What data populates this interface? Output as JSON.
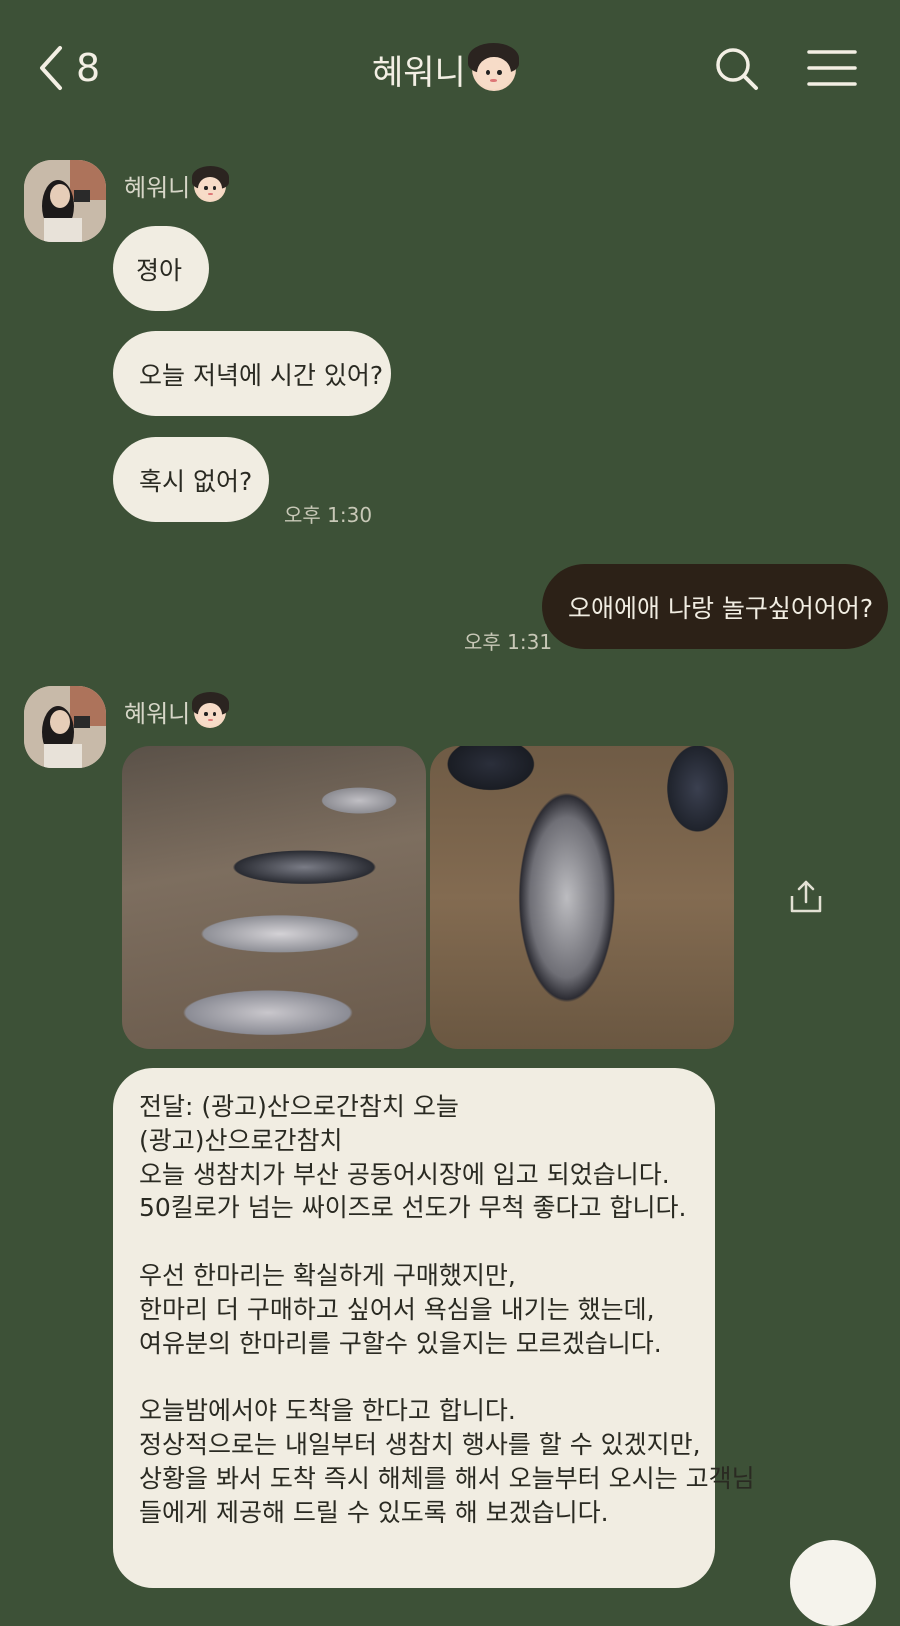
{
  "header": {
    "back_count": "8",
    "title": "혜워니"
  },
  "messages": {
    "group1": {
      "sender": "혜워니",
      "bubble1": "졍아",
      "bubble2": "오늘 저녁에 시간 있어?",
      "bubble3": "혹시 없어?",
      "time": "오후 1:30"
    },
    "mine1": {
      "text": "오애에애 나랑 놀구싶어어어?",
      "time": "오후 1:31"
    },
    "group2": {
      "sender": "혜워니",
      "long_message": [
        "전달: (광고)산으로간참치 오늘",
        "(광고)산으로간참치",
        "오늘 생참치가 부산 공동어시장에 입고 되었습니다.",
        "50킬로가 넘는 싸이즈로 선도가 무척 좋다고 합니다.",
        "",
        "우선 한마리는 확실하게 구매했지만,",
        "한마리 더 구매하고 싶어서 욕심을 내기는 했는데,",
        "여유분의 한마리를 구할수 있을지는 모르겠습니다.",
        "",
        "오늘밤에서야 도착을 한다고 합니다.",
        "정상적으로는 내일부터 생참치 행사를 할 수 있겠지만,",
        "상황을 봐서 도착 즉시 해체를 해서 오늘부터 오시는 고객님",
        "들에게 제공해 드릴 수 있도록 해 보겠습니다."
      ]
    }
  },
  "icons": {
    "back": "chevron-left-icon",
    "search": "search-icon",
    "menu": "hamburger-menu-icon",
    "share": "share-icon"
  },
  "colors": {
    "background": "#3d5137",
    "bubble_received": "#f1ede2",
    "bubble_sent": "#2c2117"
  }
}
